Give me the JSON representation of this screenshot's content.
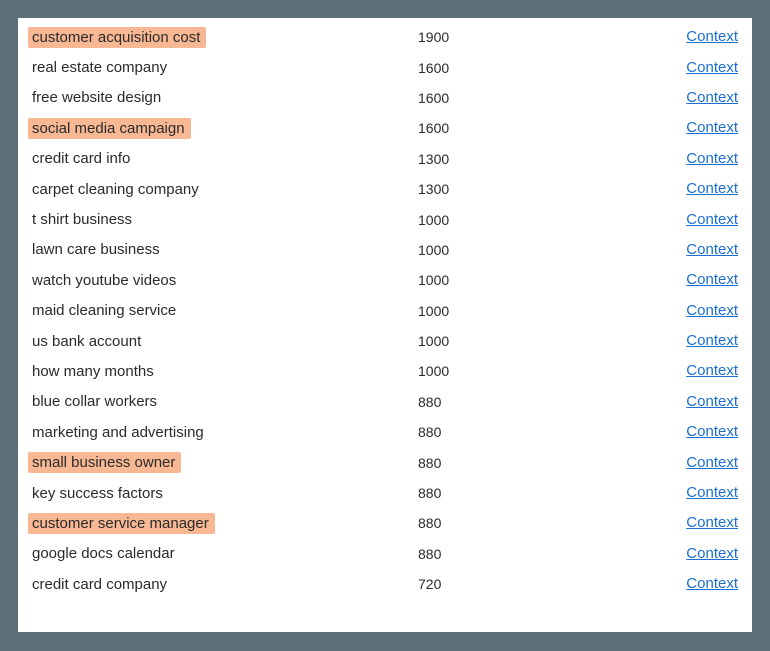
{
  "table": {
    "context_label": "Context",
    "rows": [
      {
        "term": "customer acquisition cost",
        "count": "1900",
        "highlighted": true
      },
      {
        "term": "real estate company",
        "count": "1600",
        "highlighted": false
      },
      {
        "term": "free website design",
        "count": "1600",
        "highlighted": false
      },
      {
        "term": "social media campaign",
        "count": "1600",
        "highlighted": true
      },
      {
        "term": "credit card info",
        "count": "1300",
        "highlighted": false
      },
      {
        "term": "carpet cleaning company",
        "count": "1300",
        "highlighted": false
      },
      {
        "term": "t shirt business",
        "count": "1000",
        "highlighted": false
      },
      {
        "term": "lawn care business",
        "count": "1000",
        "highlighted": false
      },
      {
        "term": "watch youtube videos",
        "count": "1000",
        "highlighted": false
      },
      {
        "term": "maid cleaning service",
        "count": "1000",
        "highlighted": false
      },
      {
        "term": "us bank account",
        "count": "1000",
        "highlighted": false
      },
      {
        "term": "how many months",
        "count": "1000",
        "highlighted": false
      },
      {
        "term": "blue collar workers",
        "count": "880",
        "highlighted": false
      },
      {
        "term": "marketing and advertising",
        "count": "880",
        "highlighted": false
      },
      {
        "term": "small business owner",
        "count": "880",
        "highlighted": true
      },
      {
        "term": "key success factors",
        "count": "880",
        "highlighted": false
      },
      {
        "term": "customer service manager",
        "count": "880",
        "highlighted": true
      },
      {
        "term": "google docs calendar",
        "count": "880",
        "highlighted": false
      },
      {
        "term": "credit card company",
        "count": "720",
        "highlighted": false
      }
    ]
  }
}
